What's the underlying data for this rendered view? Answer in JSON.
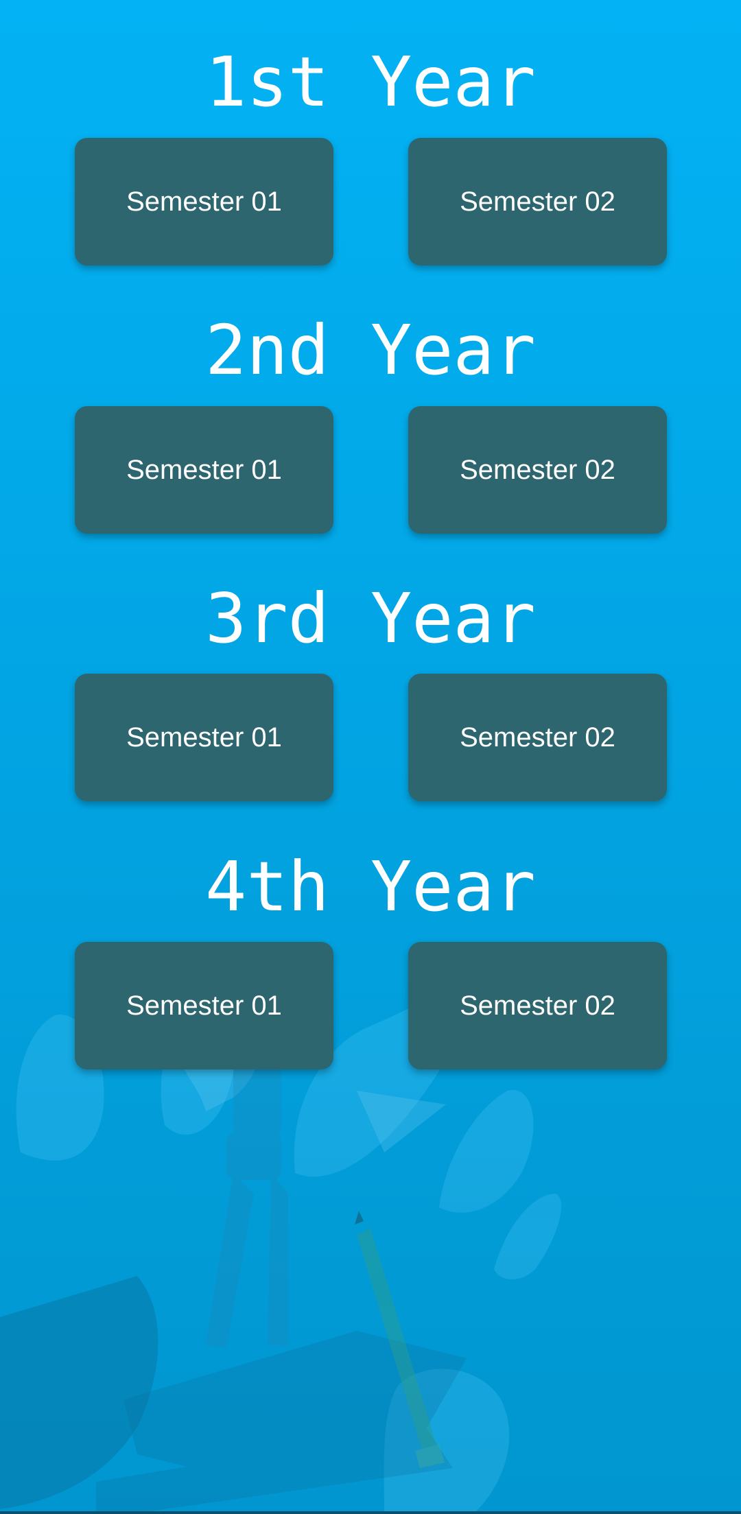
{
  "colors": {
    "background_top": "#03b2f4",
    "background_bottom": "#0196cf",
    "button_fill": "#2e6670",
    "text": "#ffffff"
  },
  "years": [
    {
      "title": "1st Year",
      "semesters": [
        "Semester 01",
        "Semester 02"
      ]
    },
    {
      "title": "2nd Year",
      "semesters": [
        "Semester 01",
        "Semester 02"
      ]
    },
    {
      "title": "3rd Year",
      "semesters": [
        "Semester 01",
        "Semester 02"
      ]
    },
    {
      "title": "4th Year",
      "semesters": [
        "Semester 01",
        "Semester 02"
      ]
    }
  ],
  "background_image": "student-books-illustration"
}
